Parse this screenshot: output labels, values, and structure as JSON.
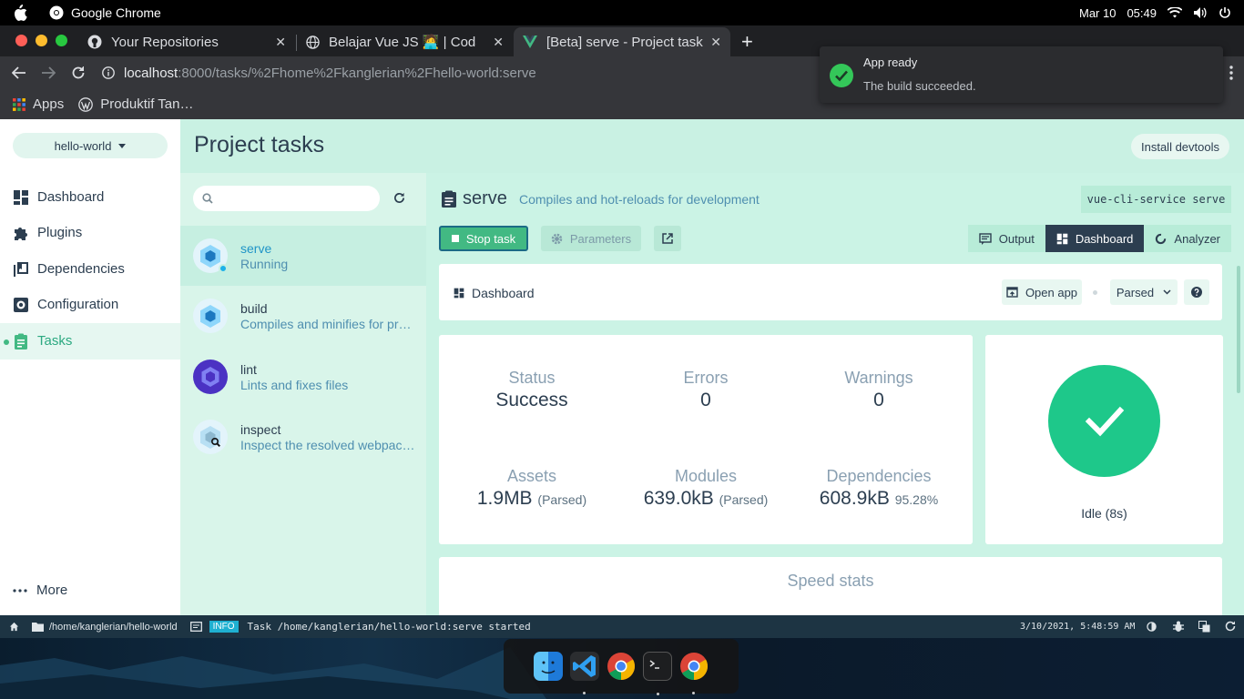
{
  "os": {
    "app_name": "Google Chrome",
    "date": "Mar 10",
    "time": "05:49"
  },
  "browser": {
    "tabs": [
      {
        "title": "Your Repositories"
      },
      {
        "title": "Belajar Vue JS 🧑‍💻 | Codale"
      },
      {
        "title": "[Beta] serve - Project tasks"
      }
    ],
    "url_host": "localhost",
    "url_path": ":8000/tasks/%2Fhome%2Fkanglerian%2Fhello-world:serve",
    "bookmarks": [
      "Apps",
      "Produktif Tan…"
    ]
  },
  "toast": {
    "title": "App ready",
    "message": "The build succeeded."
  },
  "sidebar": {
    "project": "hello-world",
    "items": [
      {
        "label": "Dashboard",
        "icon": "dashboard-icon"
      },
      {
        "label": "Plugins",
        "icon": "puzzle-icon"
      },
      {
        "label": "Dependencies",
        "icon": "library-icon"
      },
      {
        "label": "Configuration",
        "icon": "gear-icon"
      },
      {
        "label": "Tasks",
        "icon": "clipboard-icon"
      }
    ],
    "more_label": "More"
  },
  "header": {
    "title": "Project tasks",
    "devtools_label": "Install devtools"
  },
  "tasks": [
    {
      "name": "serve",
      "desc": "Running"
    },
    {
      "name": "build",
      "desc": "Compiles and minifies for production"
    },
    {
      "name": "lint",
      "desc": "Lints and fixes files"
    },
    {
      "name": "inspect",
      "desc": "Inspect the resolved webpack config"
    }
  ],
  "detail": {
    "name": "serve",
    "description": "Compiles and hot-reloads for development",
    "command": "vue-cli-service serve",
    "stop_label": "Stop task",
    "params_label": "Parameters",
    "views": [
      "Output",
      "Dashboard",
      "Analyzer"
    ],
    "dashboard_title": "Dashboard",
    "open_app_label": "Open app",
    "mode_label": "Parsed",
    "stats": {
      "status_label": "Status",
      "status_value": "Success",
      "errors_label": "Errors",
      "errors_value": "0",
      "warnings_label": "Warnings",
      "warnings_value": "0",
      "assets_label": "Assets",
      "assets_value": "1.9MB",
      "assets_note": "(Parsed)",
      "modules_label": "Modules",
      "modules_value": "639.0kB",
      "modules_note": "(Parsed)",
      "deps_label": "Dependencies",
      "deps_value": "608.9kB",
      "deps_note": "95.28%"
    },
    "idle_label": "Idle (8s)",
    "speed_title": "Speed stats"
  },
  "statusbar": {
    "path": "/home/kanglerian/hello-world",
    "level": "INFO",
    "message": "Task /home/kanglerian/hello-world:serve started",
    "timestamp": "3/10/2021, 5:48:59 AM"
  },
  "colors": {
    "accent": "#42b983",
    "header_bg": "#c9f1e3",
    "dark": "#2c3e50"
  }
}
